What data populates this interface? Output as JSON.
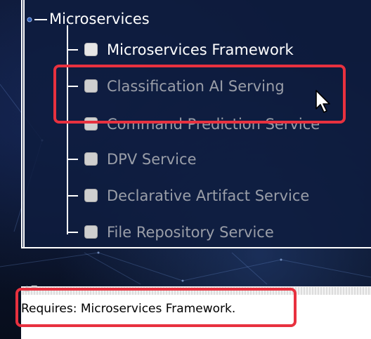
{
  "tree": {
    "root": {
      "label": "Microservices",
      "icon": "tree-node-expander-icon"
    },
    "items": [
      {
        "label": "Microservices Framework",
        "state": "enabled",
        "checked": false
      },
      {
        "label": "Classification AI Serving",
        "state": "disabled",
        "checked": false
      },
      {
        "label": "Command Prediction Service",
        "state": "disabled",
        "checked": false
      },
      {
        "label": "DPV Service",
        "state": "disabled",
        "checked": false
      },
      {
        "label": "Declarative Artifact Service",
        "state": "disabled",
        "checked": false
      },
      {
        "label": "File Repository Service",
        "state": "disabled",
        "checked": false
      }
    ]
  },
  "description": {
    "text": "Requires: Microservices Framework."
  },
  "colors": {
    "highlight": "#e8313f",
    "panel_background": "#0e1c3e",
    "enabled_text": "#ffffff",
    "disabled_text": "#9a9ea8"
  },
  "cursor": {
    "icon": "mouse-pointer-icon"
  }
}
